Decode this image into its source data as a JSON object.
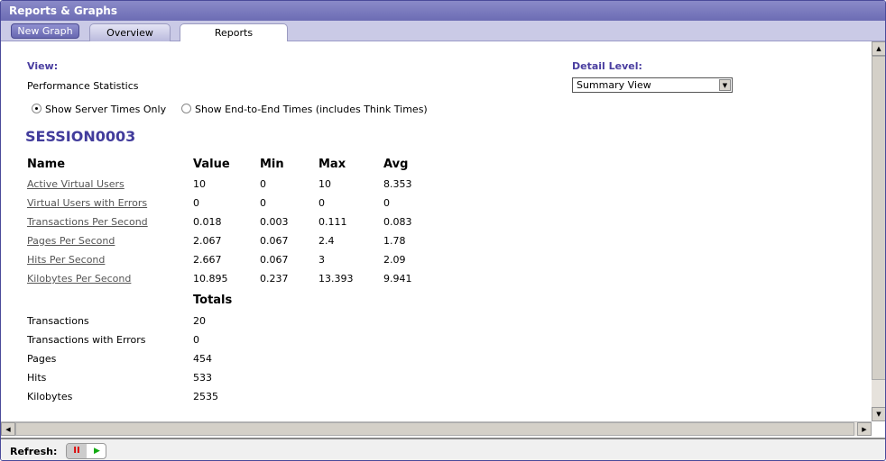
{
  "window": {
    "title": "Reports & Graphs"
  },
  "toolbar": {
    "new_graph": "New Graph",
    "tabs": [
      {
        "label": "Overview",
        "active": false
      },
      {
        "label": "Reports",
        "active": true
      }
    ]
  },
  "view": {
    "label": "View:",
    "value": "Performance Statistics",
    "radios": [
      {
        "label": "Show Server Times Only",
        "checked": true
      },
      {
        "label": "Show End-to-End Times (includes Think Times)",
        "checked": false
      }
    ]
  },
  "detail": {
    "label": "Detail Level:",
    "selected": "Summary View"
  },
  "session": "SESSION0003",
  "stats": {
    "headers": [
      "Name",
      "Value",
      "Min",
      "Max",
      "Avg"
    ],
    "rows": [
      [
        "Active Virtual Users",
        "10",
        "0",
        "10",
        "8.353"
      ],
      [
        "Virtual Users with Errors",
        "0",
        "0",
        "0",
        "0"
      ],
      [
        "Transactions Per Second",
        "0.018",
        "0.003",
        "0.111",
        "0.083"
      ],
      [
        "Pages Per Second",
        "2.067",
        "0.067",
        "2.4",
        "1.78"
      ],
      [
        "Hits Per Second",
        "2.667",
        "0.067",
        "3",
        "2.09"
      ],
      [
        "Kilobytes Per Second",
        "10.895",
        "0.237",
        "13.393",
        "9.941"
      ]
    ]
  },
  "totals": {
    "header": "Totals",
    "rows": [
      [
        "Transactions",
        "20"
      ],
      [
        "Transactions with Errors",
        "0"
      ],
      [
        "Pages",
        "454"
      ],
      [
        "Hits",
        "533"
      ],
      [
        "Kilobytes",
        "2535"
      ]
    ]
  },
  "footer": {
    "refresh_label": "Refresh:",
    "pause_icon": "pause-icon",
    "play_icon": "play-icon"
  }
}
